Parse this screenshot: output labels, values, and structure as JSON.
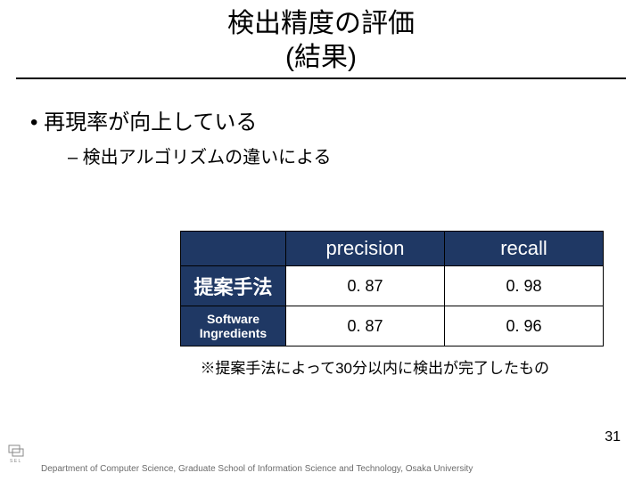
{
  "title_line1": "検出精度の評価",
  "title_line2": "(結果)",
  "bullet1": "• 再現率が向上している",
  "bullet2": "– 検出アルゴリズムの違いによる",
  "table": {
    "col_headers": [
      "precision",
      "recall"
    ],
    "rows": [
      {
        "label": "提案手法",
        "precision": "0. 87",
        "recall": "0. 98"
      },
      {
        "label_l1": "Software",
        "label_l2": "Ingredients",
        "precision": "0. 87",
        "recall": "0. 96"
      }
    ]
  },
  "note": "※提案手法によって30分以内に検出が完了したもの",
  "page_number": "31",
  "footer": "Department of Computer Science, Graduate School of Information Science and Technology, Osaka University",
  "chart_data": {
    "type": "table",
    "title": "検出精度の評価 (結果)",
    "columns": [
      "",
      "precision",
      "recall"
    ],
    "rows": [
      [
        "提案手法",
        0.87,
        0.98
      ],
      [
        "Software Ingredients",
        0.87,
        0.96
      ]
    ]
  }
}
